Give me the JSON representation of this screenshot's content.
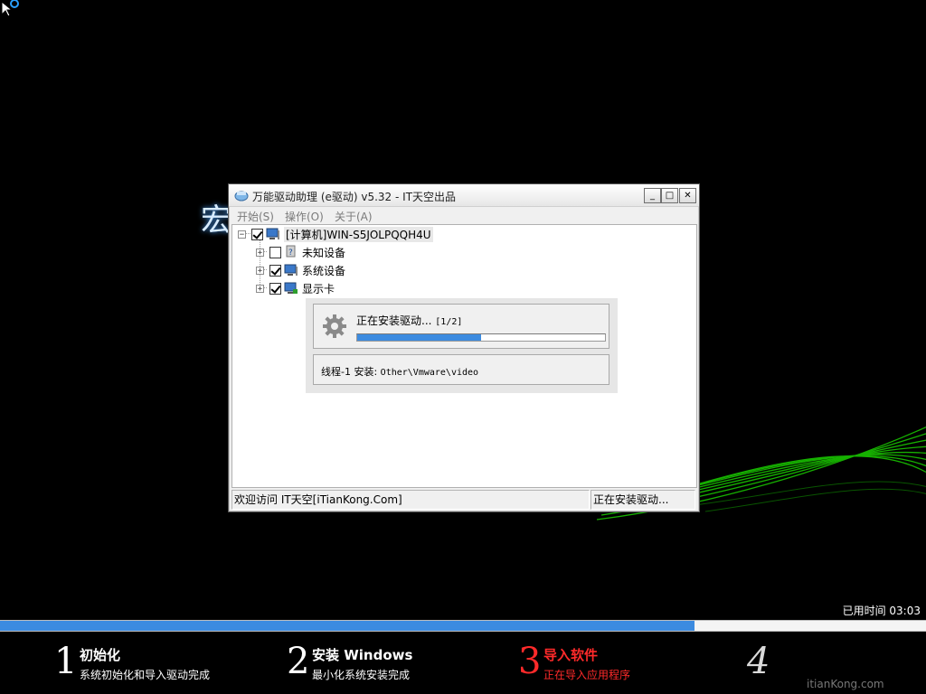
{
  "background": {
    "brand_partial": "宏"
  },
  "window": {
    "title": "万能驱动助理 (e驱动) v5.32 - IT天空出品",
    "controls": {
      "minimize": "_",
      "maximize": "□",
      "close": "✕"
    },
    "menu": [
      "开始(S)",
      "操作(O)",
      "关于(A)"
    ],
    "tree": {
      "root": {
        "label": "[计算机]WIN-S5JOLPQQH4U",
        "checked": true,
        "expander": "−"
      },
      "children": [
        {
          "label": "未知设备",
          "checked": false,
          "expander": "+"
        },
        {
          "label": "系统设备",
          "checked": true,
          "expander": "+"
        },
        {
          "label": "显示卡",
          "checked": true,
          "expander": "+"
        }
      ]
    },
    "install_dialog": {
      "status_label": "正在安装驱动...",
      "counter": "[1/2]",
      "progress": 0.5,
      "thread_label": "线程-1 安装:",
      "thread_path": "Other\\Vmware\\video"
    },
    "statusbar": {
      "left": "欢迎访问 IT天空[iTianKong.Com]",
      "right": "正在安装驱动..."
    }
  },
  "footer": {
    "elapsed_label": "已用时间",
    "elapsed_time": "03:03",
    "overall_progress": 0.75,
    "steps": [
      {
        "num": "1",
        "title": "初始化",
        "subtitle": "系统初始化和导入驱动完成",
        "active": false
      },
      {
        "num": "2",
        "title": "安装 Windows",
        "subtitle": "最小化系统安装完成",
        "active": false
      },
      {
        "num": "3",
        "title": "导入软件",
        "subtitle": "正在导入应用程序",
        "active": true
      },
      {
        "num": "4",
        "title": "",
        "subtitle": "",
        "active": false
      }
    ],
    "watermark": "itianKong.com"
  },
  "colors": {
    "accent": "#3c8be0",
    "active_step": "#ff2a2a",
    "swoosh": "#19c400"
  }
}
